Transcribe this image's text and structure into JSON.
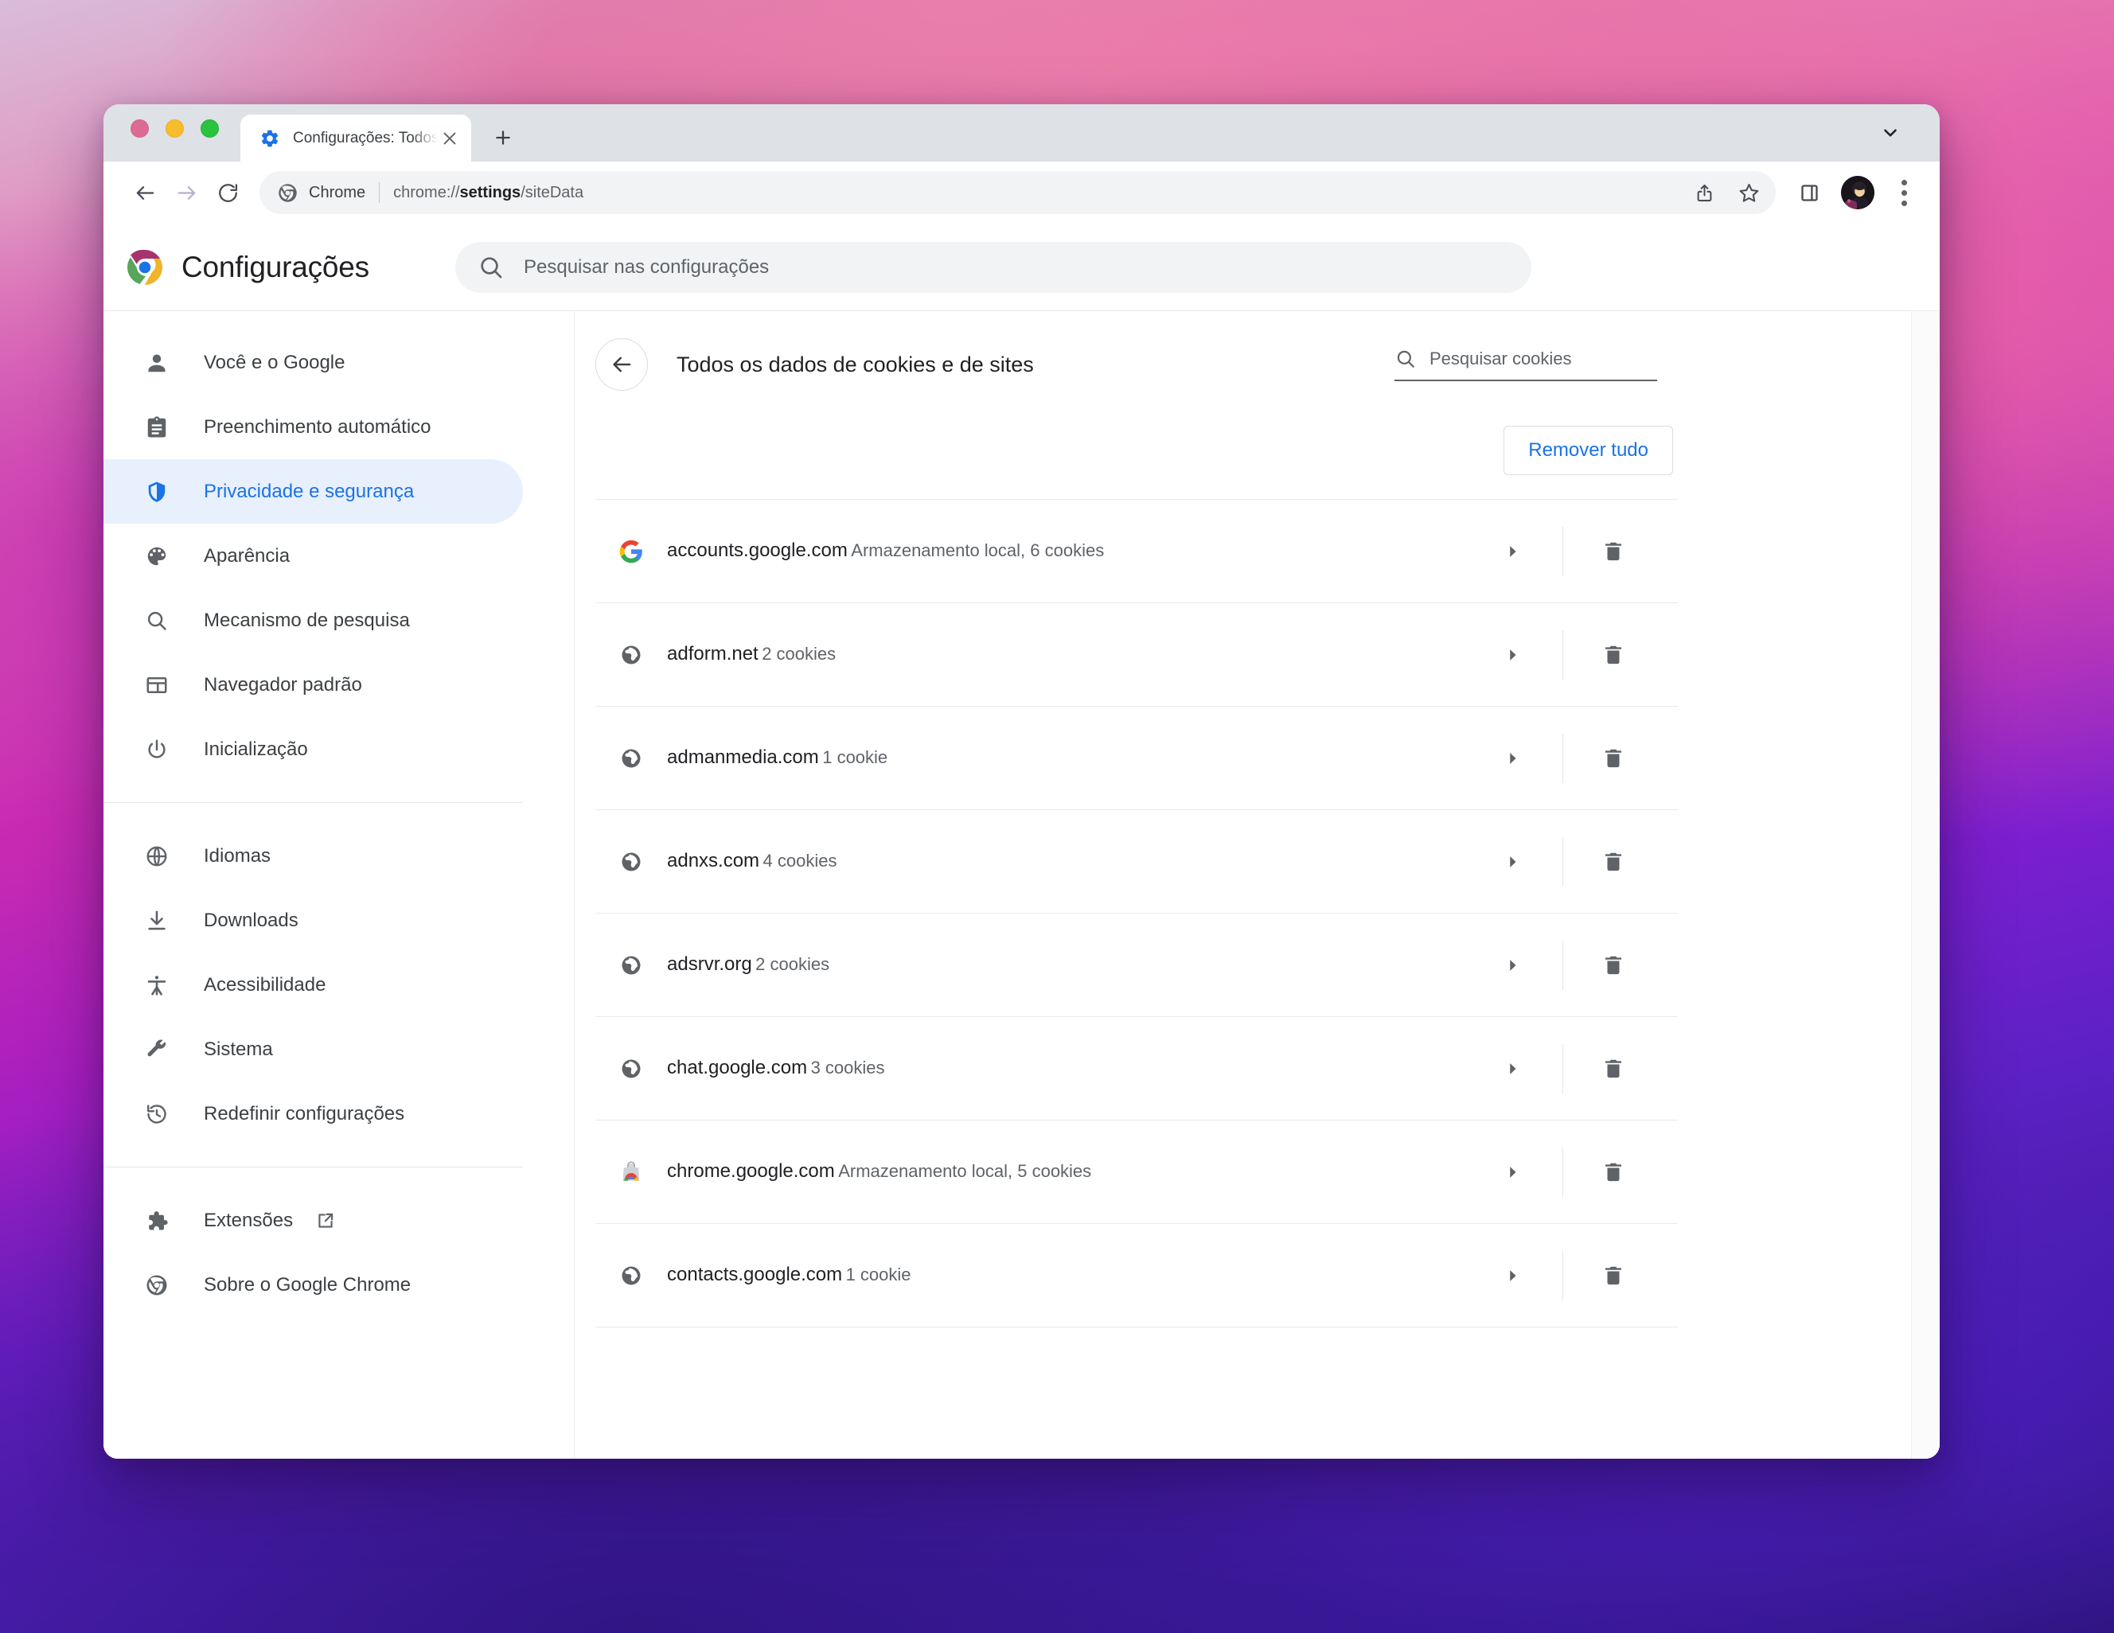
{
  "window": {
    "traffic_lights": [
      "close",
      "minimize",
      "maximize"
    ],
    "tabstrip": {
      "tabs": [
        {
          "favicon": "gear-icon",
          "title": "Configurações: Todos os dados",
          "close_label": "×"
        }
      ],
      "new_tab_label": "+",
      "tab_list_chevron": "chevron-down-icon"
    },
    "toolbar": {
      "back_label": "←",
      "forward_label": "→",
      "reload_label": "⟳",
      "omnibox": {
        "icon": "chrome-icon",
        "scheme_label": "Chrome",
        "url_prefix": "chrome://",
        "url_bold": "settings",
        "url_suffix": "/siteData"
      },
      "share_label": "share-icon",
      "bookmark_label": "star-icon",
      "side_panel_label": "side-panel-icon",
      "avatar_label": "profile-avatar",
      "menu_label": "three-dot-menu"
    }
  },
  "settings": {
    "logo": "chrome-logo",
    "title": "Configurações",
    "search": {
      "placeholder": "Pesquisar nas configurações",
      "value": "",
      "icon": "search-icon"
    }
  },
  "sidebar": {
    "groups": [
      {
        "items": [
          {
            "icon": "person-icon",
            "label": "Você e o Google",
            "selected": false
          },
          {
            "icon": "clipboard-icon",
            "label": "Preenchimento automático",
            "selected": false
          },
          {
            "icon": "shield-icon",
            "label": "Privacidade e segurança",
            "selected": true
          },
          {
            "icon": "palette-icon",
            "label": "Aparência",
            "selected": false
          },
          {
            "icon": "search-icon",
            "label": "Mecanismo de pesquisa",
            "selected": false
          },
          {
            "icon": "browser-icon",
            "label": "Navegador padrão",
            "selected": false
          },
          {
            "icon": "power-icon",
            "label": "Inicialização",
            "selected": false
          }
        ]
      },
      {
        "items": [
          {
            "icon": "globe-icon",
            "label": "Idiomas",
            "selected": false
          },
          {
            "icon": "download-icon",
            "label": "Downloads",
            "selected": false
          },
          {
            "icon": "accessibility-icon",
            "label": "Acessibilidade",
            "selected": false
          },
          {
            "icon": "wrench-icon",
            "label": "Sistema",
            "selected": false
          },
          {
            "icon": "restore-icon",
            "label": "Redefinir configurações",
            "selected": false
          }
        ]
      },
      {
        "items": [
          {
            "icon": "puzzle-icon",
            "label": "Extensões",
            "selected": false,
            "external": true
          },
          {
            "icon": "chrome-icon",
            "label": "Sobre o Google Chrome",
            "selected": false
          }
        ]
      }
    ]
  },
  "content": {
    "back_button": "back-arrow-icon",
    "title": "Todos os dados de cookies e de sites",
    "cookie_search": {
      "placeholder": "Pesquisar cookies",
      "value": "",
      "icon": "search-icon"
    },
    "remove_all_label": "Remover tudo",
    "rows": [
      {
        "favicon": "google-g-icon",
        "name": "accounts.google.com",
        "desc": "Armazenamento local, 6 cookies",
        "expand": "chevron-right-icon",
        "delete": "trash-icon"
      },
      {
        "favicon": "globe-icon",
        "name": "adform.net",
        "desc": "2 cookies",
        "expand": "chevron-right-icon",
        "delete": "trash-icon"
      },
      {
        "favicon": "globe-icon",
        "name": "admanmedia.com",
        "desc": "1 cookie",
        "expand": "chevron-right-icon",
        "delete": "trash-icon"
      },
      {
        "favicon": "globe-icon",
        "name": "adnxs.com",
        "desc": "4 cookies",
        "expand": "chevron-right-icon",
        "delete": "trash-icon"
      },
      {
        "favicon": "globe-icon",
        "name": "adsrvr.org",
        "desc": "2 cookies",
        "expand": "chevron-right-icon",
        "delete": "trash-icon"
      },
      {
        "favicon": "globe-icon",
        "name": "chat.google.com",
        "desc": "3 cookies",
        "expand": "chevron-right-icon",
        "delete": "trash-icon"
      },
      {
        "favicon": "webstore-icon",
        "name": "chrome.google.com",
        "desc": "Armazenamento local, 5 cookies",
        "expand": "chevron-right-icon",
        "delete": "trash-icon"
      },
      {
        "favicon": "globe-icon",
        "name": "contacts.google.com",
        "desc": "1 cookie",
        "expand": "chevron-right-icon",
        "delete": "trash-icon"
      }
    ]
  },
  "colors": {
    "accent_blue": "#1a73e8",
    "selected_bg": "#e8f0fe",
    "tab_strip_bg": "#dee1e6",
    "omnibox_bg": "#f1f3f4",
    "text_primary": "#202124",
    "text_secondary": "#5f6368",
    "divider": "#e9eaec"
  }
}
